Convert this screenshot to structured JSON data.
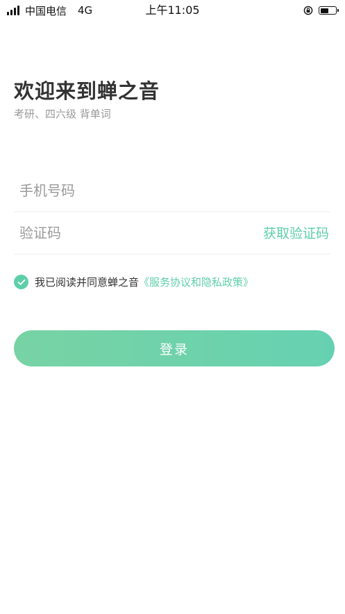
{
  "status_bar": {
    "carrier": "中国电信",
    "network": "4G",
    "time": "上午11:05"
  },
  "header": {
    "title": "欢迎来到蝉之音",
    "subtitle": "考研、四六级 背单词"
  },
  "form": {
    "phone_placeholder": "手机号码",
    "code_placeholder": "验证码",
    "get_code_label": "获取验证码"
  },
  "agreement": {
    "text": "我已阅读并同意蝉之音",
    "link": "《服务协议和隐私政策》",
    "checked": true
  },
  "login_button_label": "登录",
  "colors": {
    "accent": "#5fcfa9",
    "button_start": "#78d3a4",
    "button_end": "#66d1b1",
    "title": "#333333",
    "subtitle": "#999999"
  },
  "battery_level": 0.55
}
